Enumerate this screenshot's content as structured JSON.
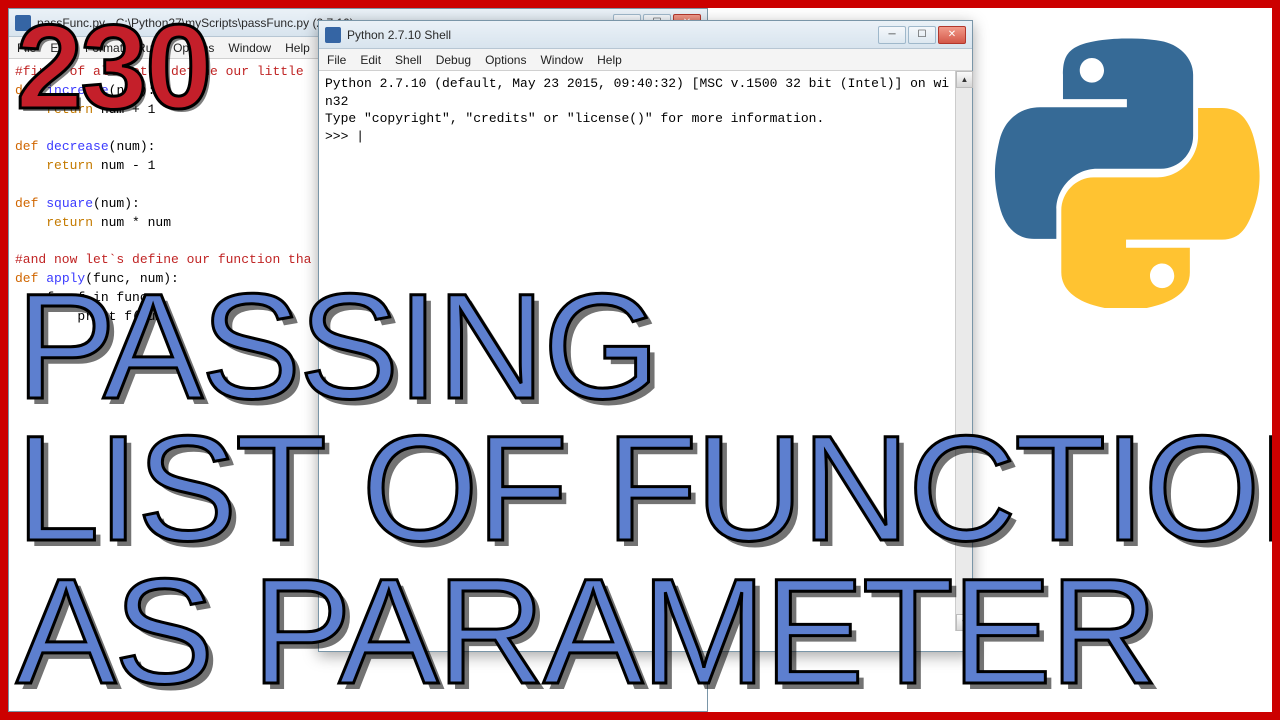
{
  "editor": {
    "title": "passFunc.py - C:\\Python27\\myScripts\\passFunc.py (2.7.10)",
    "menus": [
      "File",
      "Edit",
      "Format",
      "Run",
      "Options",
      "Window",
      "Help"
    ],
    "code": {
      "c1": "#first of all let`s define our little ",
      "def": "def",
      "fn_increase": "increase",
      "sig": "(num):",
      "ret": "    return",
      "inc_body": " num + 1",
      "fn_decrease": "decrease",
      "dec_body": " num - 1",
      "fn_square": "square",
      "sq_body": " num * num",
      "c2": "#and now let`s define our function tha",
      "fn_apply": "apply",
      "apply_sig": "(func, num):",
      "loop": "    for f in func:",
      "pr": "        print f(num)"
    }
  },
  "shell": {
    "title": "Python 2.7.10 Shell",
    "menus": [
      "File",
      "Edit",
      "Shell",
      "Debug",
      "Options",
      "Window",
      "Help"
    ],
    "line1": "Python 2.7.10 (default, May 23 2015, 09:40:32) [MSC v.1500 32 bit (Intel)] on wi",
    "line2": "n32",
    "line3": "Type \"copyright\", \"credits\" or \"license()\" for more information.",
    "prompt": ">>> "
  },
  "overlay": {
    "num": "230",
    "line1": "PASSING",
    "line2": "LIST OF FUNCTIONS",
    "line3": "AS PARAMETER"
  },
  "win_buttons": {
    "min": "─",
    "max": "☐",
    "close": "✕"
  }
}
